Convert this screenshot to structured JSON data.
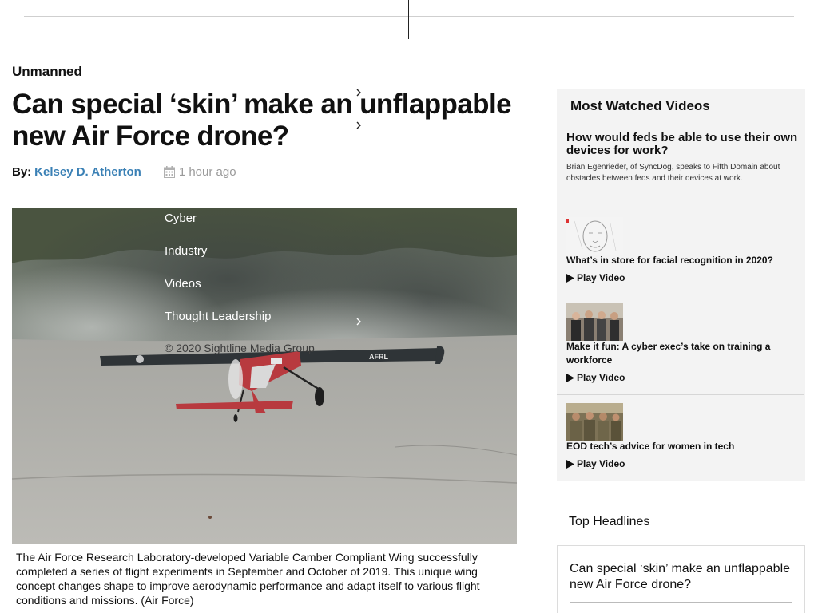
{
  "article": {
    "section": "Unmanned",
    "headline": "Can special ‘skin’ make an unflappable new Air Force drone?",
    "byline_prefix": "By:",
    "author": "Kelsey D. Atherton",
    "timestamp": "1 hour ago",
    "caption": "The Air Force Research Laboratory-developed Variable Camber Compliant Wing successfully completed a series of flight experiments in September and October of 2019. This unique wing concept changes shape to improve aerodynamic performance and adapt itself to various flight conditions and missions. (Air Force)",
    "image_alt": "Small unmanned aircraft on a runway",
    "wing_markings": [
      "AFRL"
    ]
  },
  "nav_menu": {
    "items": [
      "Cyber",
      "Industry",
      "Videos",
      "Thought Leadership"
    ],
    "copyright": "© 2020 Sightline Media Group"
  },
  "sidebar": {
    "most_watched_title": "Most Watched Videos",
    "featured": {
      "title": "How would feds be able to use their own devices for work?",
      "description": "Brian Egenrieder, of SyncDog, speaks to Fifth Domain about obstacles between feds and their devices at work."
    },
    "videos": [
      {
        "title": "What’s in store for facial recognition in 2020?",
        "play_label": "Play Video",
        "thumb_icon": "face-sketch-thumbnail"
      },
      {
        "title": "Make it fun: A cyber exec’s take on training a workforce",
        "play_label": "Play Video",
        "thumb_icon": "group-photo-thumbnail"
      },
      {
        "title": "EOD tech’s advice for women in tech",
        "play_label": "Play Video",
        "thumb_icon": "soldiers-photo-thumbnail"
      }
    ],
    "top_headlines_label": "Top Headlines",
    "top_headlines": [
      "Can special ‘skin’ make an unflappable new Air Force drone?"
    ]
  },
  "colors": {
    "author_link": "#3a80b5",
    "muted": "#9a9a9a",
    "sidebar_bg": "#f3f3f3"
  }
}
